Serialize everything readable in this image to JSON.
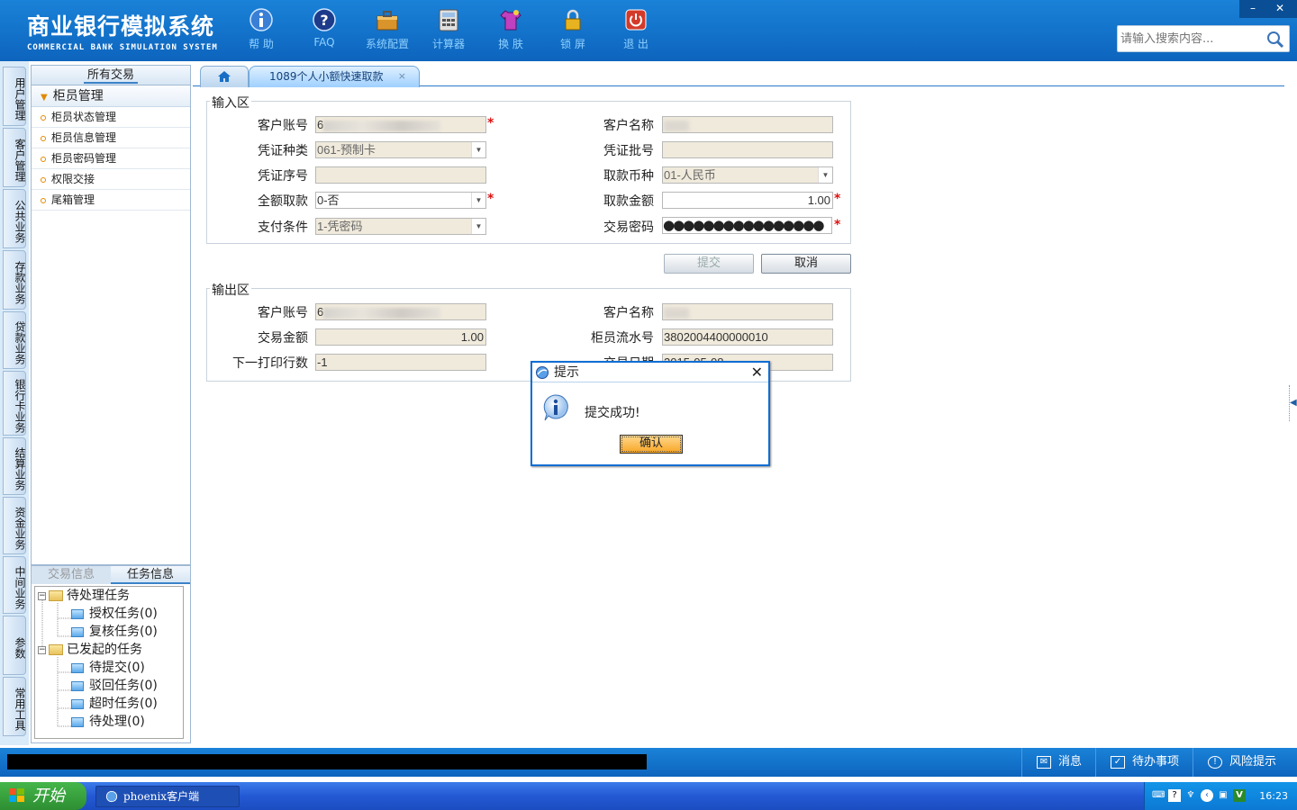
{
  "app": {
    "title_cn": "商业银行模拟系统",
    "title_en": "COMMERCIAL BANK SIMULATION SYSTEM",
    "minimize": "–",
    "close": "✕"
  },
  "toolbar": [
    {
      "label": "帮 助",
      "icon": "info-icon"
    },
    {
      "label": "FAQ",
      "icon": "question-icon"
    },
    {
      "label": "系统配置",
      "icon": "toolbox-icon"
    },
    {
      "label": "计算器",
      "icon": "calculator-icon"
    },
    {
      "label": "换 肤",
      "icon": "shirt-icon"
    },
    {
      "label": "锁 屏",
      "icon": "lock-icon"
    },
    {
      "label": "退 出",
      "icon": "power-icon"
    }
  ],
  "search": {
    "placeholder": "请输入搜索内容..."
  },
  "left_tabs": [
    "用户管理",
    "客户管理",
    "公共业务",
    "存款业务",
    "贷款业务",
    "银行卡业务",
    "结算业务",
    "资金业务",
    "中间业务",
    "参数",
    "常用工具"
  ],
  "nav": {
    "header": "所有交易",
    "group": "柜员管理",
    "items": [
      "柜员状态管理",
      "柜员信息管理",
      "柜员密码管理",
      "权限交接",
      "尾箱管理"
    ]
  },
  "tasks": {
    "tabs": [
      "交易信息",
      "任务信息"
    ],
    "tree": [
      {
        "label": "待处理任务",
        "children": [
          "授权任务(0)",
          "复核任务(0)"
        ]
      },
      {
        "label": "已发起的任务",
        "children": [
          "待提交(0)",
          "驳回任务(0)",
          "超时任务(0)",
          "待处理(0)"
        ]
      }
    ]
  },
  "tabs": {
    "active": "1089个人小额快速取款",
    "close": "×"
  },
  "input": {
    "legend": "输入区",
    "account_label": "客户账号",
    "account_value": "6",
    "name_label": "客户名称",
    "voucher_type_label": "凭证种类",
    "voucher_type_value": "061-预制卡",
    "voucher_batch_label": "凭证批号",
    "voucher_batch_value": "",
    "voucher_seq_label": "凭证序号",
    "voucher_seq_value": "",
    "currency_label": "取款币种",
    "currency_value": "01-人民币",
    "full_withdraw_label": "全额取款",
    "full_withdraw_value": "0-否",
    "amount_label": "取款金额",
    "amount_value": "1.00",
    "pay_cond_label": "支付条件",
    "pay_cond_value": "1-凭密码",
    "password_label": "交易密码",
    "password_value": "●●●●●●●●●●●●●●●●"
  },
  "buttons": {
    "submit": "提交",
    "cancel": "取消"
  },
  "output": {
    "legend": "输出区",
    "account_label": "客户账号",
    "account_value": "6",
    "name_label": "客户名称",
    "amount_label": "交易金额",
    "amount_value": "1.00",
    "serial_label": "柜员流水号",
    "serial_value": "3802004400000010",
    "next_line_label": "下一打印行数",
    "next_line_value": "-1",
    "date_label": "交易日期",
    "date_value": "2015-05-08"
  },
  "dialog": {
    "title": "提示",
    "message": "提交成功!",
    "ok": "确认",
    "close": "✕"
  },
  "statusbar": {
    "items": [
      {
        "label": "消息",
        "icon": "message-icon"
      },
      {
        "label": "待办事项",
        "icon": "checkbox-icon"
      },
      {
        "label": "风险提示",
        "icon": "speech-icon"
      }
    ]
  },
  "taskbar": {
    "start": "开始",
    "window": "phoenix客户端",
    "clock": "16:23"
  },
  "colors": {
    "header_blue": "#0d64bd",
    "required": "#d11111",
    "dialog_border": "#0f6dd4",
    "ok_orange": "#f8a626",
    "start_green": "#2d8e32"
  }
}
